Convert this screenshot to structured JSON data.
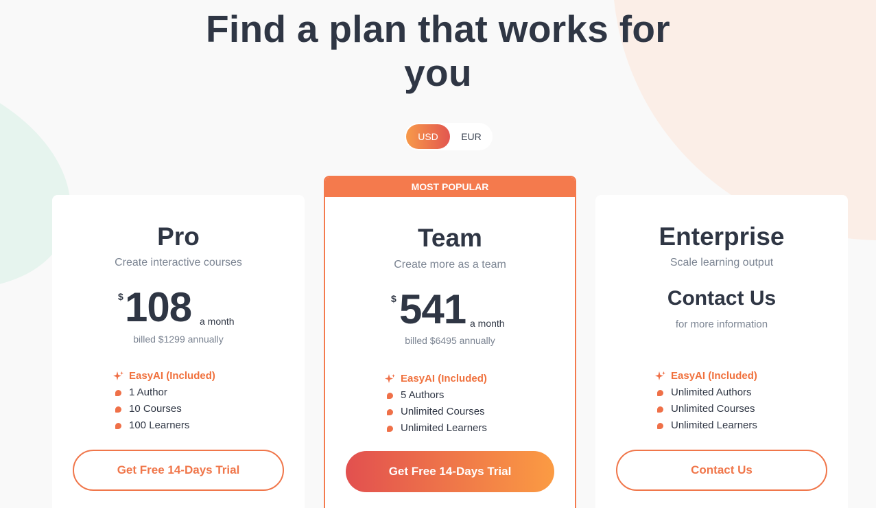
{
  "heading": {
    "line1": "Find a plan that works for",
    "line2": "you"
  },
  "currency": {
    "options": [
      "USD",
      "EUR"
    ],
    "selected": "USD"
  },
  "plans": [
    {
      "name": "Pro",
      "subtitle": "Create interactive courses",
      "currency_symbol": "$",
      "price": "108",
      "period": "a month",
      "billed": "billed $1299 annually",
      "features": [
        "EasyAI (Included)",
        "1 Author",
        "10 Courses",
        "100 Learners"
      ],
      "cta": "Get Free 14-Days Trial"
    },
    {
      "badge": "MOST POPULAR",
      "name": "Team",
      "subtitle": "Create more as a team",
      "currency_symbol": "$",
      "price": "541",
      "period": "a month",
      "billed": "billed $6495 annually",
      "features": [
        "EasyAI (Included)",
        "5 Authors",
        "Unlimited Courses",
        "Unlimited Learners"
      ],
      "cta": "Get Free 14-Days Trial"
    },
    {
      "name": "Enterprise",
      "subtitle": "Scale learning output",
      "contact_title": "Contact Us",
      "contact_sub": "for more information",
      "features": [
        "EasyAI (Included)",
        "Unlimited Authors",
        "Unlimited Courses",
        "Unlimited Learners"
      ],
      "cta": "Contact Us"
    }
  ],
  "colors": {
    "accent": "#f0764a",
    "text": "#2f3644",
    "muted": "#7b8492"
  }
}
